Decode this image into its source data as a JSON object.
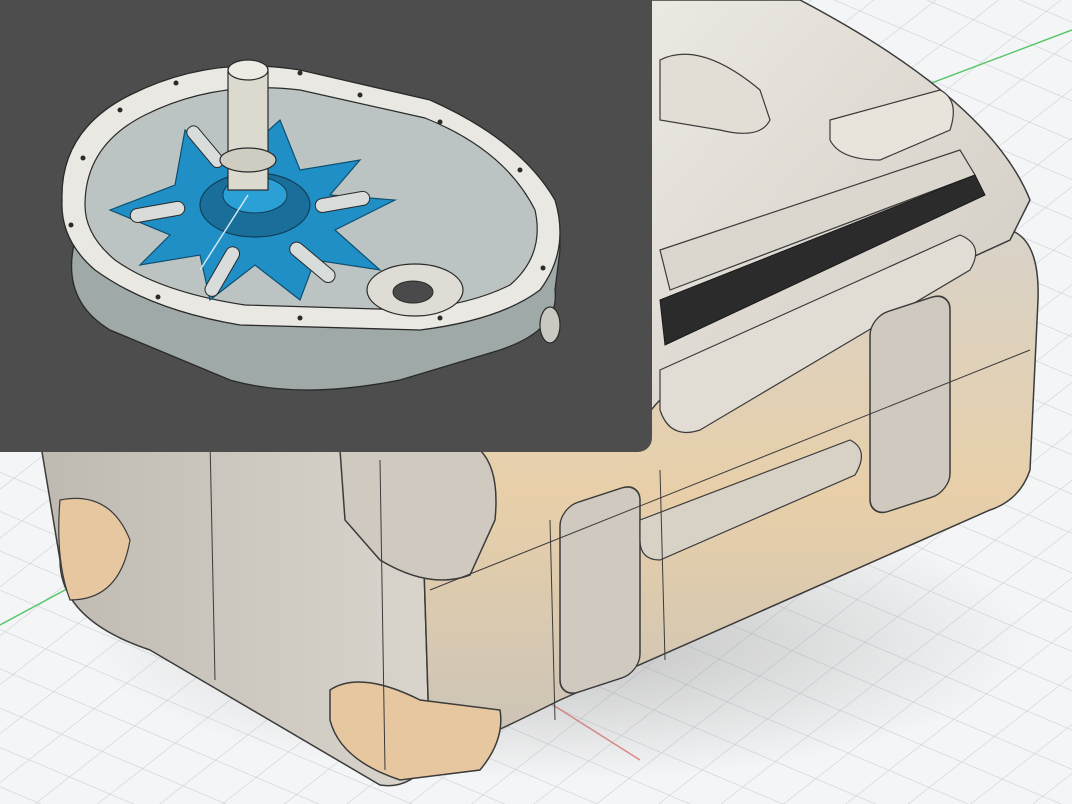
{
  "app": {
    "title": ""
  },
  "viewport": {
    "background_color": "#f4f5f6",
    "grid_line_color": "#c9ccd0",
    "x_axis_color": "#e06a6a",
    "y_axis_color": "#58c76a"
  },
  "main_model": {
    "body_color": "#d9d4ca",
    "translucent_color": "#e6c79f",
    "edge_color": "#3b3b3b"
  },
  "inset_preview": {
    "background_color": "#4d4d4d",
    "housing_color": "#e9e8e2",
    "rotor_color": "#1f8fc6"
  }
}
